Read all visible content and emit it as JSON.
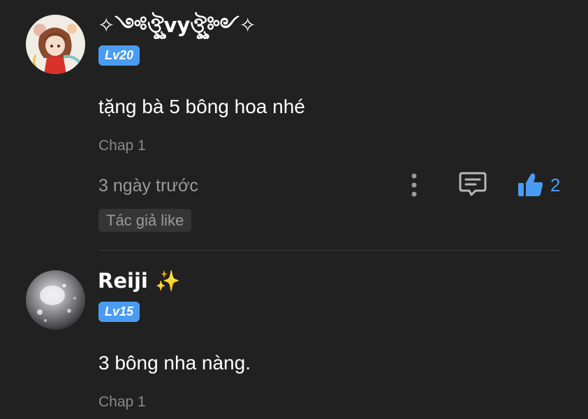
{
  "comments": [
    {
      "username": "✧༺ঔৣvyঔৣ༻✧",
      "level": "Lv20",
      "text": "tặng bà 5 bông hoa nhé",
      "chapter": "Chap 1",
      "time": "3 ngày trước",
      "likes": "2",
      "author_badge": "Tác giả like",
      "avatar_icon": "anime-girl-avatar"
    },
    {
      "username": "Reiji",
      "username_emoji": "✨",
      "level": "Lv15",
      "text": "3 bông nha nàng.",
      "chapter": "Chap 1",
      "avatar_icon": "sparkle-photo-avatar"
    }
  ],
  "colors": {
    "background": "#212121",
    "accent": "#4a9cf2",
    "muted_text": "#8a8a8a",
    "badge_bg": "#353535",
    "divider": "#3c3c3c"
  },
  "icons": {
    "more": "more-vertical-icon",
    "reply": "comment-reply-icon",
    "like": "thumbs-up-icon"
  }
}
